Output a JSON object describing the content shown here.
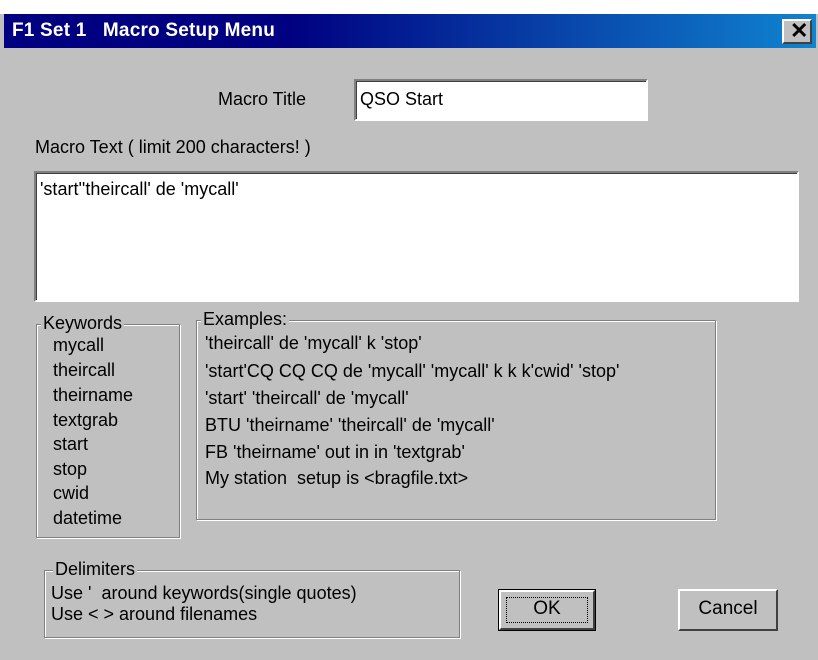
{
  "window": {
    "title": "F1 Set 1   Macro Setup Menu",
    "close_glyph": "✕"
  },
  "macro_title": {
    "label": "Macro Title",
    "value": "QSO Start"
  },
  "macro_text": {
    "label": "Macro Text ( limit 200 characters! )",
    "value": "'start''theircall' de 'mycall'"
  },
  "keywords": {
    "legend": "Keywords",
    "items": [
      "mycall",
      "theircall",
      "theirname",
      "textgrab",
      "start",
      "stop",
      "cwid",
      "datetime"
    ]
  },
  "examples": {
    "legend": "Examples:",
    "items": [
      "'theircall' de 'mycall' k 'stop'",
      "'start'CQ CQ CQ de 'mycall' 'mycall' k k k'cwid' 'stop'",
      "'start' 'theircall' de 'mycall'",
      "BTU 'theirname' 'theircall' de 'mycall'",
      "FB 'theirname' out in in 'textgrab'",
      "My station  setup is <bragfile.txt>"
    ]
  },
  "delimiters": {
    "legend": "Delimiters",
    "lines": [
      "Use '  around keywords(single quotes)",
      "Use < > around filenames"
    ]
  },
  "buttons": {
    "ok": "OK",
    "cancel": "Cancel"
  },
  "colors": {
    "titlebar_start": "#000080",
    "titlebar_end": "#1084d0",
    "face": "#c0c0c0"
  }
}
